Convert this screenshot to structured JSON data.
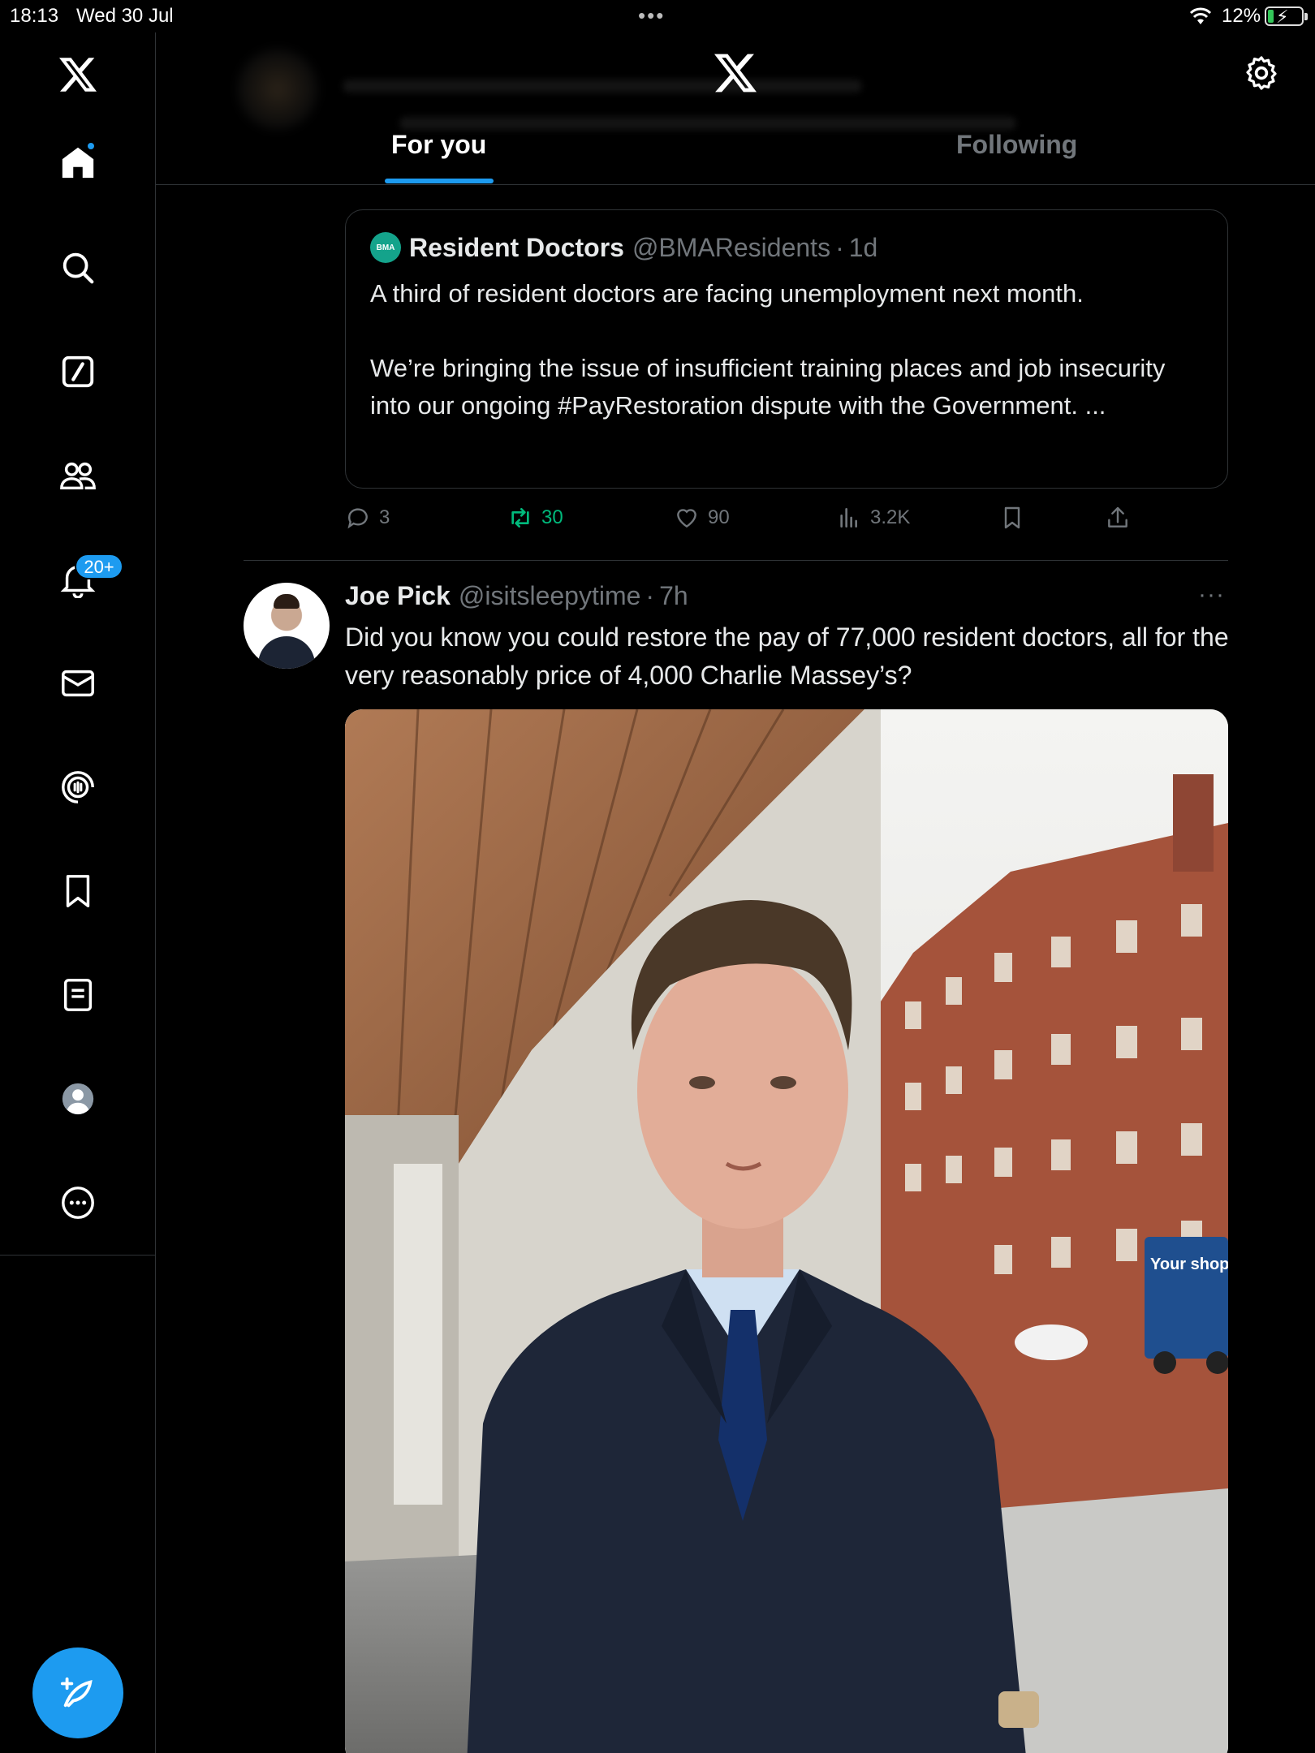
{
  "status_bar": {
    "time": "18:13",
    "date": "Wed 30 Jul",
    "battery": "12%"
  },
  "sidebar": {
    "items": [
      {
        "name": "home",
        "icon": "home-icon"
      },
      {
        "name": "explore",
        "icon": "search-icon"
      },
      {
        "name": "grok",
        "icon": "grok-icon"
      },
      {
        "name": "communities",
        "icon": "people-icon"
      },
      {
        "name": "notifications",
        "icon": "bell-icon",
        "badge": "20+"
      },
      {
        "name": "messages",
        "icon": "mail-icon"
      },
      {
        "name": "spaces",
        "icon": "spaces-icon"
      },
      {
        "name": "bookmarks",
        "icon": "bookmark-icon"
      },
      {
        "name": "lists",
        "icon": "list-icon"
      },
      {
        "name": "profile",
        "icon": "profile-icon"
      },
      {
        "name": "more",
        "icon": "more-icon"
      }
    ],
    "notifications_badge": "20+",
    "accent": "#1d9bf0"
  },
  "header": {
    "tabs": [
      {
        "label": "For you",
        "active": true
      },
      {
        "label": "Following",
        "active": false
      }
    ]
  },
  "quoted_tweet": {
    "name": "Resident Doctors",
    "handle": "@BMAResidents",
    "separator": "·",
    "time": "1d",
    "logo_text": "BMA",
    "text": "A third of resident doctors are facing unemployment   next month.\n\nWe’re bringing the issue of insufficient training places and job insecurity into our ongoing #PayRestoration dispute with the Government. ..."
  },
  "actions": {
    "replies": "3",
    "reposts": "30",
    "likes": "90",
    "views": "3.2K"
  },
  "tweet": {
    "name": "Joe Pick",
    "handle": "@isitsleepytime",
    "separator": "·",
    "time": "7h",
    "text": "Did you know you could restore the pay of 77,000 resident doctors, all for the very reasonably price of 4,000 Charlie Massey’s?",
    "more": "···",
    "media_sign_text": "Your shop"
  },
  "colors": {
    "background": "#000000",
    "text": "#e7e9ea",
    "muted": "#71767b",
    "border": "#2f3336",
    "accent": "#1d9bf0",
    "retweet": "#00ba7c"
  }
}
